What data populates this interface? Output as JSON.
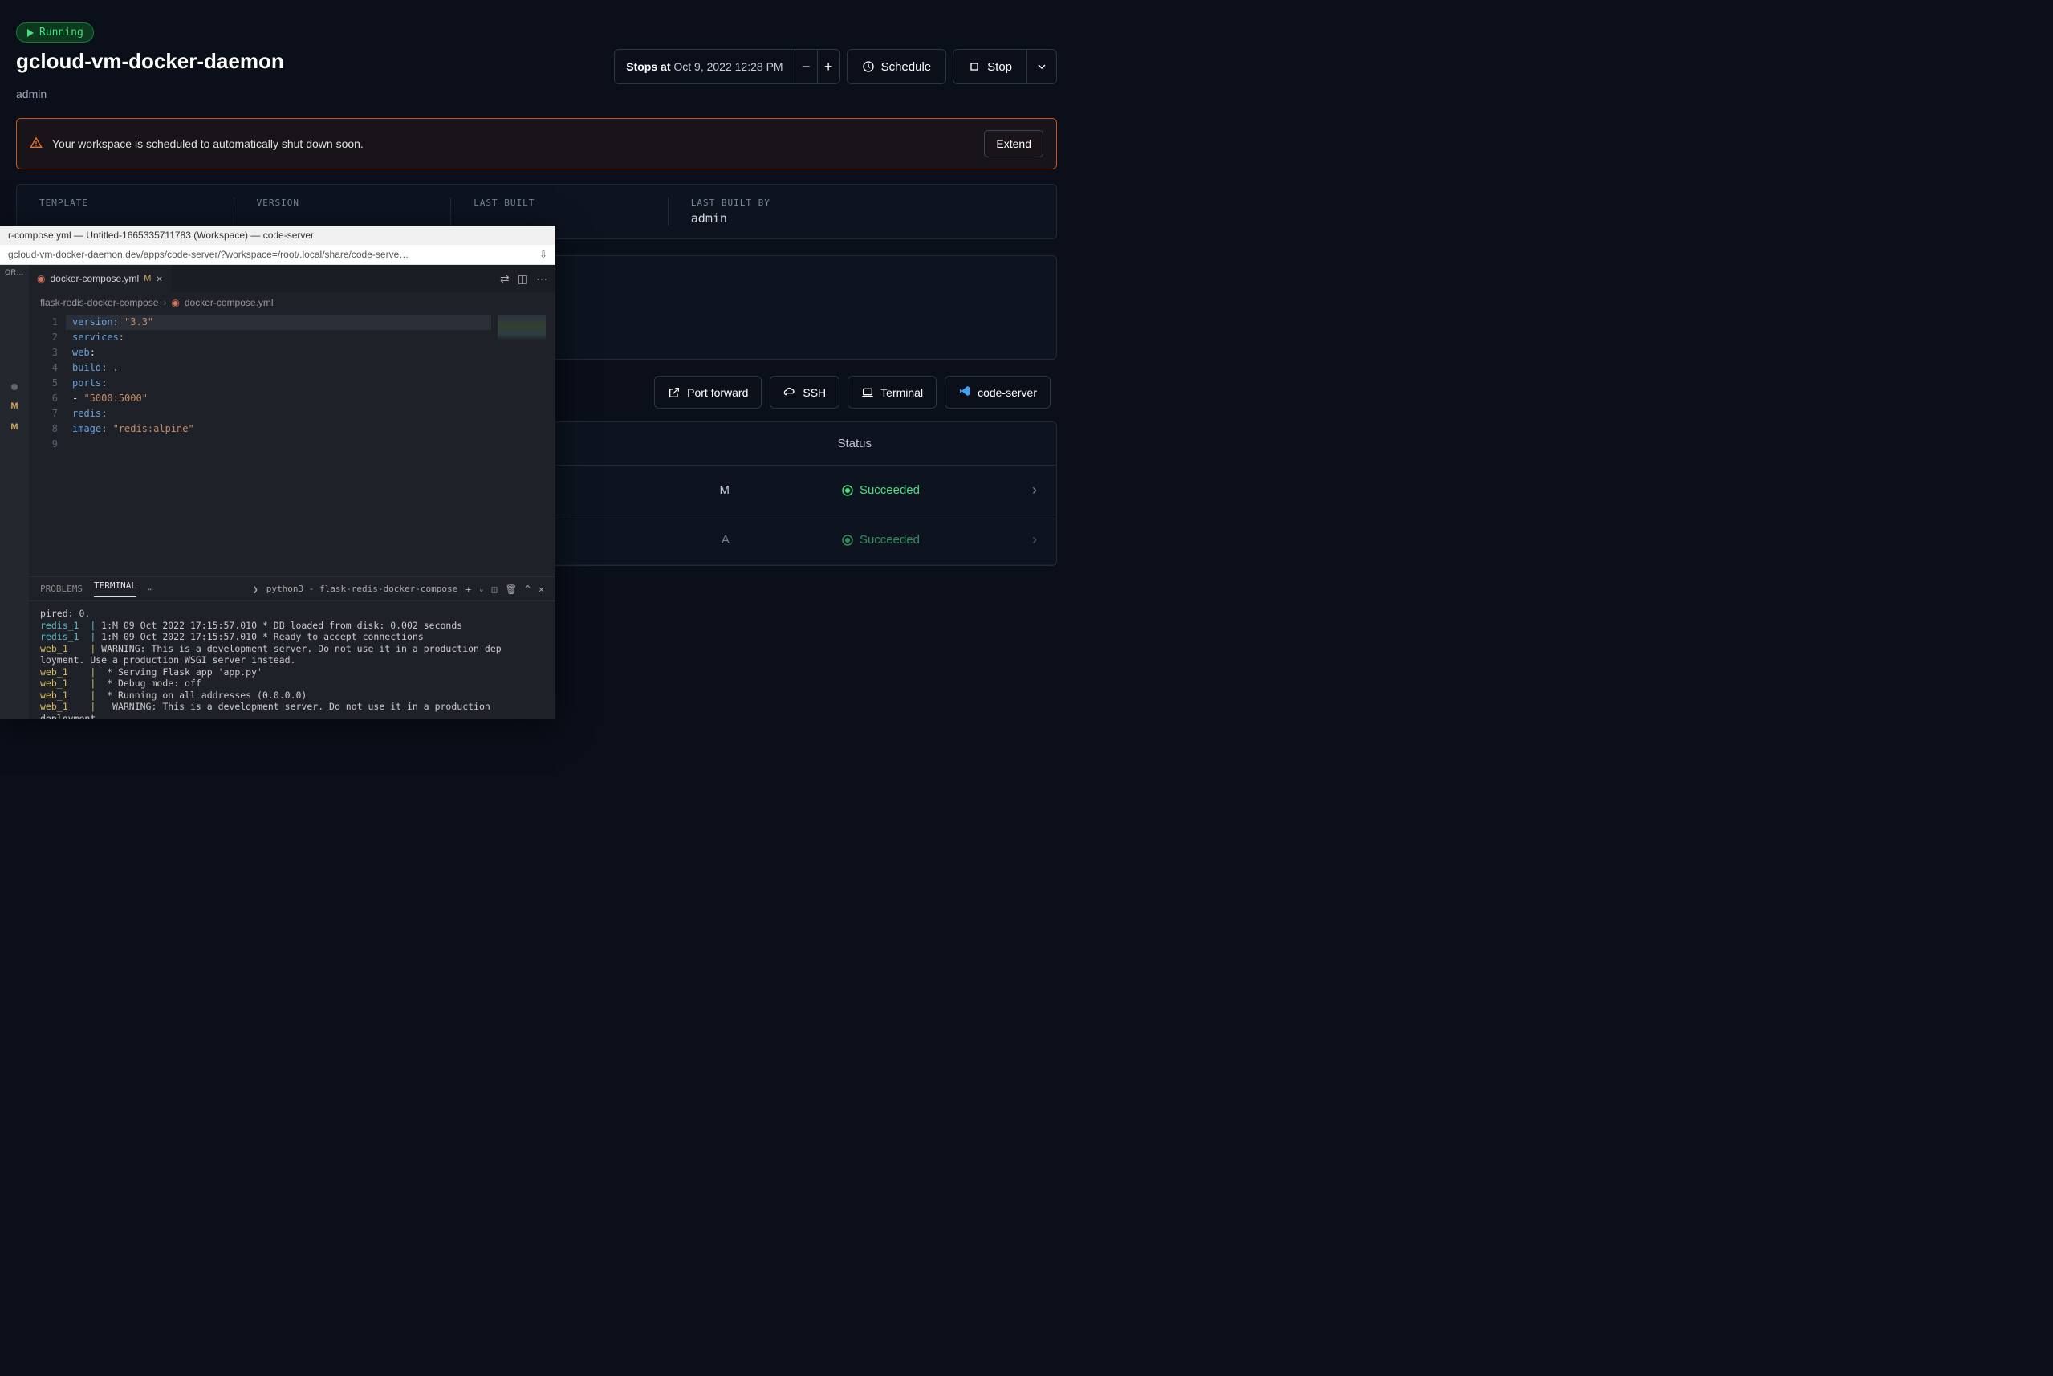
{
  "badge": {
    "label": "Running"
  },
  "title": "gcloud-vm-docker-daemon",
  "subtitle": "admin",
  "schedule": {
    "stops_label": "Stops at",
    "stops_value": "Oct 9, 2022 12:28 PM",
    "schedule_btn": "Schedule",
    "stop_btn": "Stop"
  },
  "warning": {
    "text": "Your workspace is scheduled to automatically shut down soon.",
    "extend": "Extend"
  },
  "info": {
    "template_label": "TEMPLATE",
    "version_label": "VERSION",
    "last_built_label": "LAST BUILT",
    "last_built_by_label": "LAST BUILT BY",
    "last_built_by_value": "admin"
  },
  "actions": {
    "port_forward": "Port forward",
    "ssh": "SSH",
    "terminal": "Terminal",
    "code_server": "code-server"
  },
  "status": {
    "header": "Status",
    "rows": [
      {
        "time": "M",
        "status": "Succeeded"
      },
      {
        "time": "A",
        "status": "Succeeded"
      }
    ]
  },
  "editor": {
    "window_title": "r-compose.yml — Untitled-1665335711783 (Workspace) — code-server",
    "url": "gcloud-vm-docker-daemon.dev/apps/code-server/?workspace=/root/.local/share/code-serve…",
    "explorer_label": "OR…",
    "tab": {
      "filename": "docker-compose.yml",
      "modified": "M"
    },
    "breadcrumb": {
      "folder": "flask-redis-docker-compose",
      "file": "docker-compose.yml"
    },
    "code": {
      "lines": [
        {
          "n": 1,
          "kw": "version",
          "rest": ": ",
          "str": "\"3.3\"",
          "hl": true
        },
        {
          "n": 2,
          "kw": "services",
          "rest": ":"
        },
        {
          "n": 3,
          "indent": 1,
          "kw": "web",
          "rest": ":"
        },
        {
          "n": 4,
          "indent": 2,
          "kw": "build",
          "rest": ": ."
        },
        {
          "n": 5,
          "indent": 2,
          "kw": "ports",
          "rest": ":"
        },
        {
          "n": 6,
          "indent": 3,
          "dash": "- ",
          "str": "\"5000:5000\""
        },
        {
          "n": 7,
          "indent": 1,
          "kw": "redis",
          "rest": ":"
        },
        {
          "n": 8,
          "indent": 2,
          "kw": "image",
          "rest": ": ",
          "str": "\"redis:alpine\""
        },
        {
          "n": 9
        }
      ]
    },
    "terminal": {
      "tabs": {
        "problems": "PROBLEMS",
        "terminal": "TERMINAL"
      },
      "shell": "python3 - flask-redis-docker-compose",
      "output": [
        {
          "plain": "pired: 0."
        },
        {
          "prefix": "redis_1",
          "cls": "cyan",
          "sep": "  | ",
          "text": "1:M 09 Oct 2022 17:15:57.010 * DB loaded from disk: 0.002 seconds"
        },
        {
          "prefix": "redis_1",
          "cls": "cyan",
          "sep": "  | ",
          "text": "1:M 09 Oct 2022 17:15:57.010 * Ready to accept connections"
        },
        {
          "prefix": "web_1",
          "cls": "yellow",
          "sep": "    | ",
          "text": "WARNING: This is a development server. Do not use it in a production dep"
        },
        {
          "plain": "loyment. Use a production WSGI server instead."
        },
        {
          "prefix": "web_1",
          "cls": "yellow",
          "sep": "    | ",
          "text": " * Serving Flask app 'app.py'"
        },
        {
          "prefix": "web_1",
          "cls": "yellow",
          "sep": "    | ",
          "text": " * Debug mode: off"
        },
        {
          "prefix": "web_1",
          "cls": "yellow",
          "sep": "    | ",
          "text": " * Running on all addresses (0.0.0.0)"
        },
        {
          "prefix": "web_1",
          "cls": "yellow",
          "sep": "    | ",
          "text": "  WARNING: This is a development server. Do not use it in a production "
        },
        {
          "plain": "deployment."
        }
      ]
    }
  }
}
